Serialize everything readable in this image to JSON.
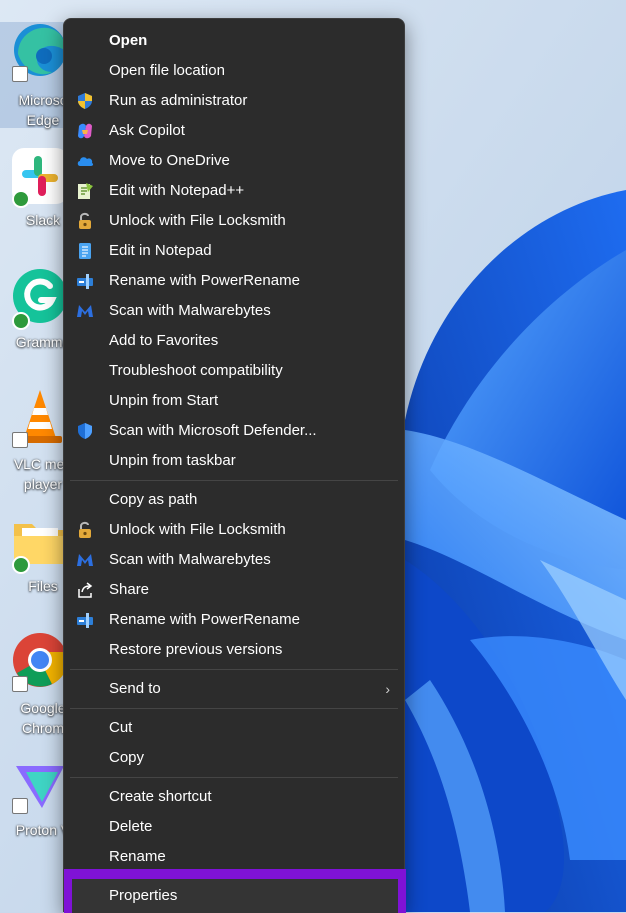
{
  "desktop": {
    "icons": [
      {
        "label_lines": [
          "Microso",
          "Edge"
        ],
        "icon": "edge-icon",
        "selected": true
      },
      {
        "label_lines": [
          "Slack"
        ],
        "icon": "slack-icon",
        "selected": false
      },
      {
        "label_lines": [
          "Gramma"
        ],
        "icon": "grammarly-icon",
        "selected": false
      },
      {
        "label_lines": [
          "VLC med",
          "player"
        ],
        "icon": "vlc-icon",
        "selected": false
      },
      {
        "label_lines": [
          "Files"
        ],
        "icon": "files-folder-icon",
        "selected": false
      },
      {
        "label_lines": [
          "Google",
          "Chrom"
        ],
        "icon": "chrome-icon",
        "selected": false
      },
      {
        "label_lines": [
          "Proton V"
        ],
        "icon": "proton-vpn-icon",
        "selected": false
      }
    ]
  },
  "menu": {
    "group1": [
      {
        "label": "Open",
        "icon": "",
        "bold": true
      },
      {
        "label": "Open file location",
        "icon": ""
      },
      {
        "label": "Run as administrator",
        "icon": "uac-shield-icon"
      },
      {
        "label": "Ask Copilot",
        "icon": "copilot-icon"
      },
      {
        "label": "Move to OneDrive",
        "icon": "onedrive-cloud-icon"
      },
      {
        "label": "Edit with Notepad++",
        "icon": "notepad-plus-plus-icon"
      },
      {
        "label": "Unlock with File Locksmith",
        "icon": "lock-icon"
      },
      {
        "label": "Edit in Notepad",
        "icon": "notepad-icon"
      },
      {
        "label": "Rename with PowerRename",
        "icon": "powerrename-icon"
      },
      {
        "label": "Scan with Malwarebytes",
        "icon": "malwarebytes-icon"
      },
      {
        "label": "Add to Favorites",
        "icon": ""
      },
      {
        "label": "Troubleshoot compatibility",
        "icon": ""
      },
      {
        "label": "Unpin from Start",
        "icon": ""
      },
      {
        "label": "Scan with Microsoft Defender...",
        "icon": "defender-shield-icon"
      },
      {
        "label": "Unpin from taskbar",
        "icon": ""
      }
    ],
    "group2": [
      {
        "label": "Copy as path",
        "icon": ""
      },
      {
        "label": "Unlock with File Locksmith",
        "icon": "lock-icon"
      },
      {
        "label": "Scan with Malwarebytes",
        "icon": "malwarebytes-icon"
      },
      {
        "label": "Share",
        "icon": "share-icon"
      },
      {
        "label": "Rename with PowerRename",
        "icon": "powerrename-icon"
      },
      {
        "label": "Restore previous versions",
        "icon": ""
      }
    ],
    "group3": [
      {
        "label": "Send to",
        "icon": "",
        "submenu": true
      }
    ],
    "group4": [
      {
        "label": "Cut",
        "icon": ""
      },
      {
        "label": "Copy",
        "icon": ""
      }
    ],
    "group5": [
      {
        "label": "Create shortcut",
        "icon": ""
      },
      {
        "label": "Delete",
        "icon": ""
      },
      {
        "label": "Rename",
        "icon": ""
      }
    ],
    "properties_label": "Properties",
    "submenu_chevron": "›",
    "highlight_color": "#7f12d6"
  }
}
